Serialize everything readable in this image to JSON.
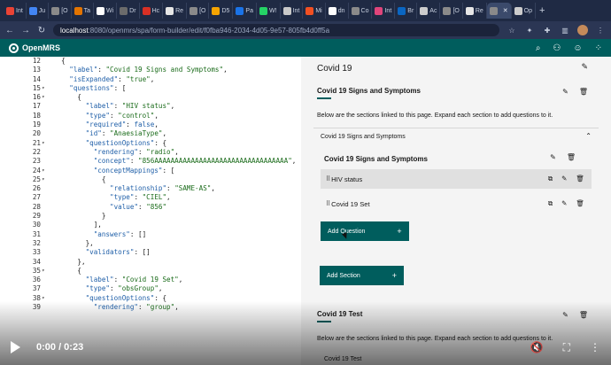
{
  "browser": {
    "tabs": [
      {
        "label": "Int",
        "color": "#ea4335"
      },
      {
        "label": "Ju",
        "color": "#4285f4"
      },
      {
        "label": "[O",
        "color": "#8a8a8a"
      },
      {
        "label": "Ta",
        "color": "#e37400"
      },
      {
        "label": "Wi",
        "color": "#ffffff"
      },
      {
        "label": "Dr",
        "color": "#6b6b6b"
      },
      {
        "label": "Hc",
        "color": "#d93025"
      },
      {
        "label": "Re",
        "color": "#e6e6e6"
      },
      {
        "label": "[O",
        "color": "#8a8a8a"
      },
      {
        "label": "D5",
        "color": "#f4a300"
      },
      {
        "label": "Pa",
        "color": "#1a73e8"
      },
      {
        "label": "W!",
        "color": "#25d366"
      },
      {
        "label": "Int",
        "color": "#c9c9c9"
      },
      {
        "label": "Mi",
        "color": "#f25022"
      },
      {
        "label": "dn",
        "color": "#ffffff"
      },
      {
        "label": "Co",
        "color": "#8a8a8a"
      },
      {
        "label": "Int",
        "color": "#e0457b"
      },
      {
        "label": "Br",
        "color": "#0a66c2"
      },
      {
        "label": "Ac",
        "color": "#cccccc"
      },
      {
        "label": "[O",
        "color": "#8a8a8a"
      },
      {
        "label": "Re",
        "color": "#e6e6e6"
      },
      {
        "label": "",
        "color": "#8a8a8a",
        "active": true
      },
      {
        "label": "Op",
        "color": "#cccccc"
      }
    ],
    "url_host": "localhost",
    "url_path": ":8080/openmrs/spa/form-builder/edit/f0fba946-2034-4d05-9e57-805fb4d0ff5a"
  },
  "app": {
    "name": "OpenMRS"
  },
  "editor": {
    "lines": [
      {
        "n": "12",
        "fold": false,
        "html": "  {"
      },
      {
        "n": "13",
        "fold": false,
        "html": "    <span class=\"k\">\"label\"</span>: <span class=\"s\">\"Covid 19 Signs and Symptoms\"</span>,"
      },
      {
        "n": "14",
        "fold": false,
        "html": "    <span class=\"k\">\"isExpanded\"</span>: <span class=\"s\">\"true\"</span>,"
      },
      {
        "n": "15",
        "fold": true,
        "html": "    <span class=\"k\">\"questions\"</span>: ["
      },
      {
        "n": "16",
        "fold": true,
        "html": "      {"
      },
      {
        "n": "17",
        "fold": false,
        "html": "        <span class=\"k\">\"label\"</span>: <span class=\"s\">\"HIV status\"</span>,"
      },
      {
        "n": "18",
        "fold": false,
        "html": "        <span class=\"k\">\"type\"</span>: <span class=\"s\">\"control\"</span>,"
      },
      {
        "n": "19",
        "fold": false,
        "html": "        <span class=\"k\">\"required\"</span>: <span class=\"b\">false</span>,"
      },
      {
        "n": "20",
        "fold": false,
        "html": "        <span class=\"k\">\"id\"</span>: <span class=\"s\">\"AnaesiaType\"</span>,"
      },
      {
        "n": "21",
        "fold": true,
        "html": "        <span class=\"k\">\"questionOptions\"</span>: {"
      },
      {
        "n": "22",
        "fold": false,
        "html": "          <span class=\"k\">\"rendering\"</span>: <span class=\"s\">\"radio\"</span>,"
      },
      {
        "n": "23",
        "fold": false,
        "html": "          <span class=\"k\">\"concept\"</span>: <span class=\"s\">\"856AAAAAAAAAAAAAAAAAAAAAAAAAAAAAAAAA\"</span>,"
      },
      {
        "n": "24",
        "fold": true,
        "html": "          <span class=\"k\">\"conceptMappings\"</span>: ["
      },
      {
        "n": "25",
        "fold": true,
        "html": "            {"
      },
      {
        "n": "26",
        "fold": false,
        "html": "              <span class=\"k\">\"relationship\"</span>: <span class=\"s\">\"SAME-AS\"</span>,"
      },
      {
        "n": "27",
        "fold": false,
        "html": "              <span class=\"k\">\"type\"</span>: <span class=\"s\">\"CIEL\"</span>,"
      },
      {
        "n": "28",
        "fold": false,
        "html": "              <span class=\"k\">\"value\"</span>: <span class=\"s\">\"856\"</span>"
      },
      {
        "n": "29",
        "fold": false,
        "html": "            }"
      },
      {
        "n": "30",
        "fold": false,
        "html": "          ],"
      },
      {
        "n": "31",
        "fold": false,
        "html": "          <span class=\"k\">\"answers\"</span>: []"
      },
      {
        "n": "32",
        "fold": false,
        "html": "        },"
      },
      {
        "n": "33",
        "fold": false,
        "html": "        <span class=\"k\">\"validators\"</span>: []"
      },
      {
        "n": "34",
        "fold": false,
        "html": "      },"
      },
      {
        "n": "35",
        "fold": true,
        "html": "      {"
      },
      {
        "n": "36",
        "fold": false,
        "html": "        <span class=\"k\">\"label\"</span>: <span class=\"s\">\"Covid 19 Set\"</span>,"
      },
      {
        "n": "37",
        "fold": false,
        "html": "        <span class=\"k\">\"type\"</span>: <span class=\"s\">\"obsGroup\"</span>,"
      },
      {
        "n": "38",
        "fold": true,
        "html": "        <span class=\"k\">\"questionOptions\"</span>: {"
      },
      {
        "n": "39",
        "fold": false,
        "html": "          <span class=\"k\">\"rendering\"</span>: <span class=\"s\">\"group\"</span>,"
      }
    ]
  },
  "builder": {
    "page_title": "Covid 19",
    "section1": {
      "title": "Covid 19 Signs and Symptoms",
      "description": "Below are the sections linked to this page. Expand each section to add questions to it.",
      "accordion_title": "Covid 19 Signs and Symptoms",
      "inner_title": "Covid 19 Signs and Symptoms",
      "questions": [
        {
          "label": "HIV status"
        },
        {
          "label": "Covid 19 Set"
        }
      ],
      "add_question_label": "Add Question",
      "add_section_label": "Add Section"
    },
    "section2": {
      "title": "Covid 19 Test",
      "description": "Below are the sections linked to this page. Expand each section to add questions to it.",
      "accordion_title": "Covid 19 Test"
    }
  },
  "video": {
    "time": "0:00 / 0:23"
  }
}
